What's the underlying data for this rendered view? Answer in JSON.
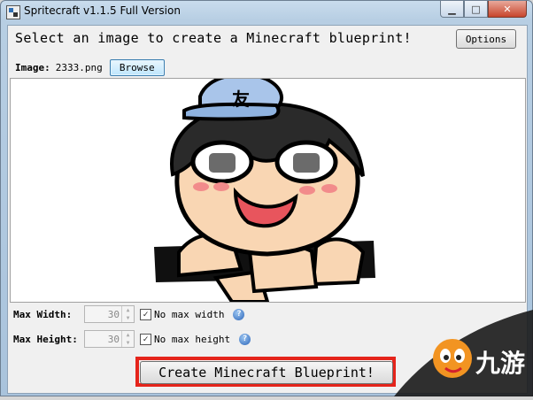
{
  "window": {
    "title": "Spritecraft v1.1.5 Full Version"
  },
  "caption": {
    "minimize": "▁",
    "maximize": "□",
    "close": "✕"
  },
  "main": {
    "prompt": "Select an image to create a Minecraft blueprint!",
    "options_label": "Options"
  },
  "image_row": {
    "label": "Image:",
    "filename": "2333.png",
    "browse_label": "Browse"
  },
  "width": {
    "label": "Max Width:",
    "value": "30",
    "checkbox_checked": true,
    "checkbox_label": "No max width"
  },
  "height": {
    "label": "Max Height:",
    "value": "30",
    "checkbox_checked": true,
    "checkbox_label": "No max height"
  },
  "create_label": "Create Minecraft Blueprint!",
  "watermark": {
    "text": "九游"
  },
  "icons": {
    "help": "?",
    "check": "✓"
  },
  "colors": {
    "highlight": "#e5241b",
    "cap": "#a9c5ea",
    "skin": "#f9d6b3"
  }
}
